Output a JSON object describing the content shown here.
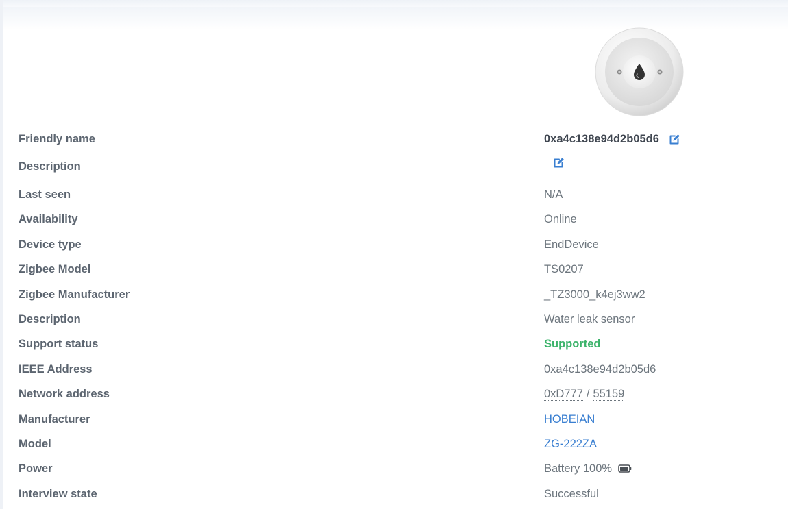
{
  "device_image": {
    "icon": "water-drop-icon"
  },
  "details": {
    "friendly_name": {
      "label": "Friendly name",
      "value": "0xa4c138e94d2b05d6",
      "edit_icon": "edit-icon"
    },
    "description_edit": {
      "label": "Description",
      "value": "",
      "edit_icon": "edit-icon"
    },
    "last_seen": {
      "label": "Last seen",
      "value": "N/A"
    },
    "availability": {
      "label": "Availability",
      "value": "Online"
    },
    "device_type": {
      "label": "Device type",
      "value": "EndDevice"
    },
    "zigbee_model": {
      "label": "Zigbee Model",
      "value": "TS0207"
    },
    "zigbee_manufacturer": {
      "label": "Zigbee Manufacturer",
      "value": "_TZ3000_k4ej3ww2"
    },
    "description": {
      "label": "Description",
      "value": "Water leak sensor"
    },
    "support_status": {
      "label": "Support status",
      "value": "Supported",
      "color": "#3bb36a"
    },
    "ieee_address": {
      "label": "IEEE Address",
      "value": "0xa4c138e94d2b05d6"
    },
    "network_address": {
      "label": "Network address",
      "hex": "0xD777",
      "separator": "/",
      "dec": "55159"
    },
    "manufacturer": {
      "label": "Manufacturer",
      "value": "HOBEIAN",
      "color": "#3a7fd1"
    },
    "model": {
      "label": "Model",
      "value": "ZG-222ZA",
      "color": "#3a7fd1"
    },
    "power": {
      "label": "Power",
      "value": "Battery 100%",
      "icon": "battery-full-icon",
      "level": 1.0
    },
    "interview_state": {
      "label": "Interview state",
      "value": "Successful"
    }
  }
}
